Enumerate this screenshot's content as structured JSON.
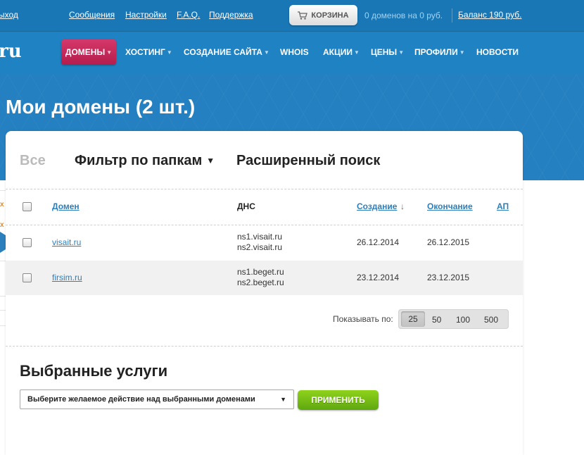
{
  "topbar": {
    "logout": "ыход",
    "messages": "Сообщения",
    "settings": "Настройки",
    "faq": "F.A.Q.",
    "support": "Поддержка",
    "cart_label": "КОРЗИНА",
    "cart_info": "0 доменов на 0 руб.",
    "balance": "Баланс 190 руб."
  },
  "logo": "ru",
  "nav": {
    "domains": "ДОМЕНЫ",
    "hosting": "ХОСТИНГ",
    "site_creation": "СОЗДАНИЕ САЙТА",
    "whois": "WHOIS",
    "promotions": "АКЦИИ",
    "prices": "ЦЕНЫ",
    "profiles": "ПРОФИЛИ",
    "news": "НОВОСТИ"
  },
  "page_title": "Мои домены (2 шт.)",
  "tabs": {
    "all": "Все",
    "folder_filter": "Фильтр по папкам",
    "advanced_search": "Расширенный поиск"
  },
  "table": {
    "headers": {
      "domain": "Домен",
      "dns": "ДНС",
      "created": "Создание",
      "expires": "Окончание",
      "auto": "АП"
    },
    "rows": [
      {
        "domain": "visait.ru",
        "dns1": "ns1.visait.ru",
        "dns2": "ns2.visait.ru",
        "created": "26.12.2014",
        "expires": "26.12.2015"
      },
      {
        "domain": "firsim.ru",
        "dns1": "ns1.beget.ru",
        "dns2": "ns2.beget.ru",
        "created": "23.12.2014",
        "expires": "23.12.2015"
      }
    ]
  },
  "pagination": {
    "label": "Показывать по:",
    "options": [
      "25",
      "50",
      "100",
      "500"
    ],
    "selected": "25"
  },
  "services": {
    "title": "Выбранные услуги",
    "select_value": "Выберите желаемое действие над выбранными доменами",
    "apply": "ПРИМЕНИТЬ"
  },
  "left_column": {
    "marker": "x"
  },
  "colors": {
    "top_bar": "#1a77b6",
    "nav_bar": "#1f82c2",
    "active_nav": "#c8285a",
    "link": "#2c7fbd",
    "apply_button": "#76bd15"
  }
}
